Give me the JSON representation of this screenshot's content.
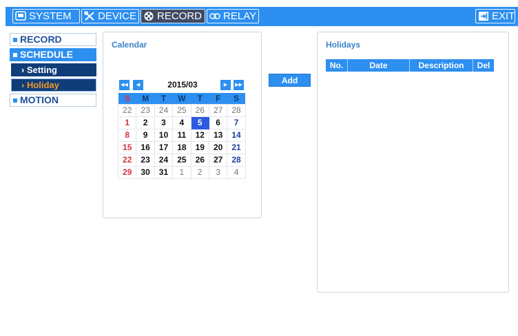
{
  "topbar": {
    "tabs": [
      {
        "label": "SYSTEM",
        "icon": "monitor-icon"
      },
      {
        "label": "DEVICE",
        "icon": "tools-icon"
      },
      {
        "label": "RECORD",
        "icon": "film-reel-icon"
      },
      {
        "label": "RELAY",
        "icon": "relay-link-icon"
      }
    ],
    "exit_label": "EXIT",
    "active_tab": "RECORD",
    "accent": "#2d8ff0"
  },
  "sidebar": {
    "record": "RECORD",
    "schedule": "SCHEDULE",
    "setting": "› Setting",
    "holiday": "› Holiday",
    "motion": "MOTION",
    "active_item": "Holiday"
  },
  "calendar": {
    "title": "Calendar",
    "month": "2015/03",
    "weekdays": [
      "S",
      "M",
      "T",
      "W",
      "T",
      "F",
      "S"
    ],
    "selected_day": "5",
    "weeks": [
      [
        "22",
        "23",
        "24",
        "25",
        "26",
        "27",
        "28"
      ],
      [
        "1",
        "2",
        "3",
        "4",
        "5",
        "6",
        "7"
      ],
      [
        "8",
        "9",
        "10",
        "11",
        "12",
        "13",
        "14"
      ],
      [
        "15",
        "16",
        "17",
        "18",
        "19",
        "20",
        "21"
      ],
      [
        "22",
        "23",
        "24",
        "25",
        "26",
        "27",
        "28"
      ],
      [
        "29",
        "30",
        "31",
        "1",
        "2",
        "3",
        "4"
      ]
    ]
  },
  "add_button": "Add",
  "holidays": {
    "title": "Holidays",
    "columns": [
      "No.",
      "Date",
      "Description",
      "Del"
    ],
    "rows": []
  }
}
